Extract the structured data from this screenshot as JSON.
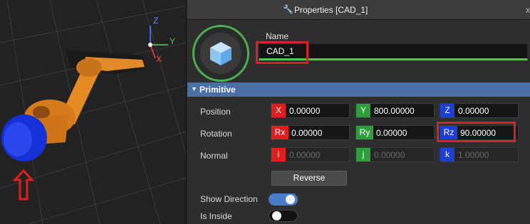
{
  "viewport": {
    "axis_labels": {
      "z": "Z",
      "y": "Y",
      "x": "X"
    }
  },
  "panel": {
    "title": "Properties [CAD_1]",
    "title_icon": "wrench-icon",
    "close_glyph": "x",
    "name_label": "Name",
    "name_value": "CAD_1",
    "accent_color": "#5ec24e"
  },
  "section": {
    "title": "Primitive",
    "color": "#4a6fa5"
  },
  "rows": {
    "position": {
      "label": "Position",
      "x_tag": "X",
      "x": "0.00000",
      "y_tag": "Y",
      "y": "800.00000",
      "z_tag": "Z",
      "z": "0.00000"
    },
    "rotation": {
      "label": "Rotation",
      "rx_tag": "Rx",
      "rx": "0.00000",
      "ry_tag": "Ry",
      "ry": "0.00000",
      "rz_tag": "Rz",
      "rz": "90.00000"
    },
    "normal": {
      "label": "Normal",
      "i_tag": "i",
      "i": "0.00000",
      "j_tag": "j",
      "j": "0.00000",
      "k_tag": "k",
      "k": "1.00000"
    }
  },
  "reverse_button": "Reverse",
  "show_direction": {
    "label": "Show Direction",
    "on": true
  },
  "is_inside": {
    "label": "Is Inside",
    "on": false
  },
  "colors": {
    "x": "#e01e1e",
    "y": "#2e9e3c",
    "z": "#1d3fd6",
    "highlight": "#d0252a"
  }
}
